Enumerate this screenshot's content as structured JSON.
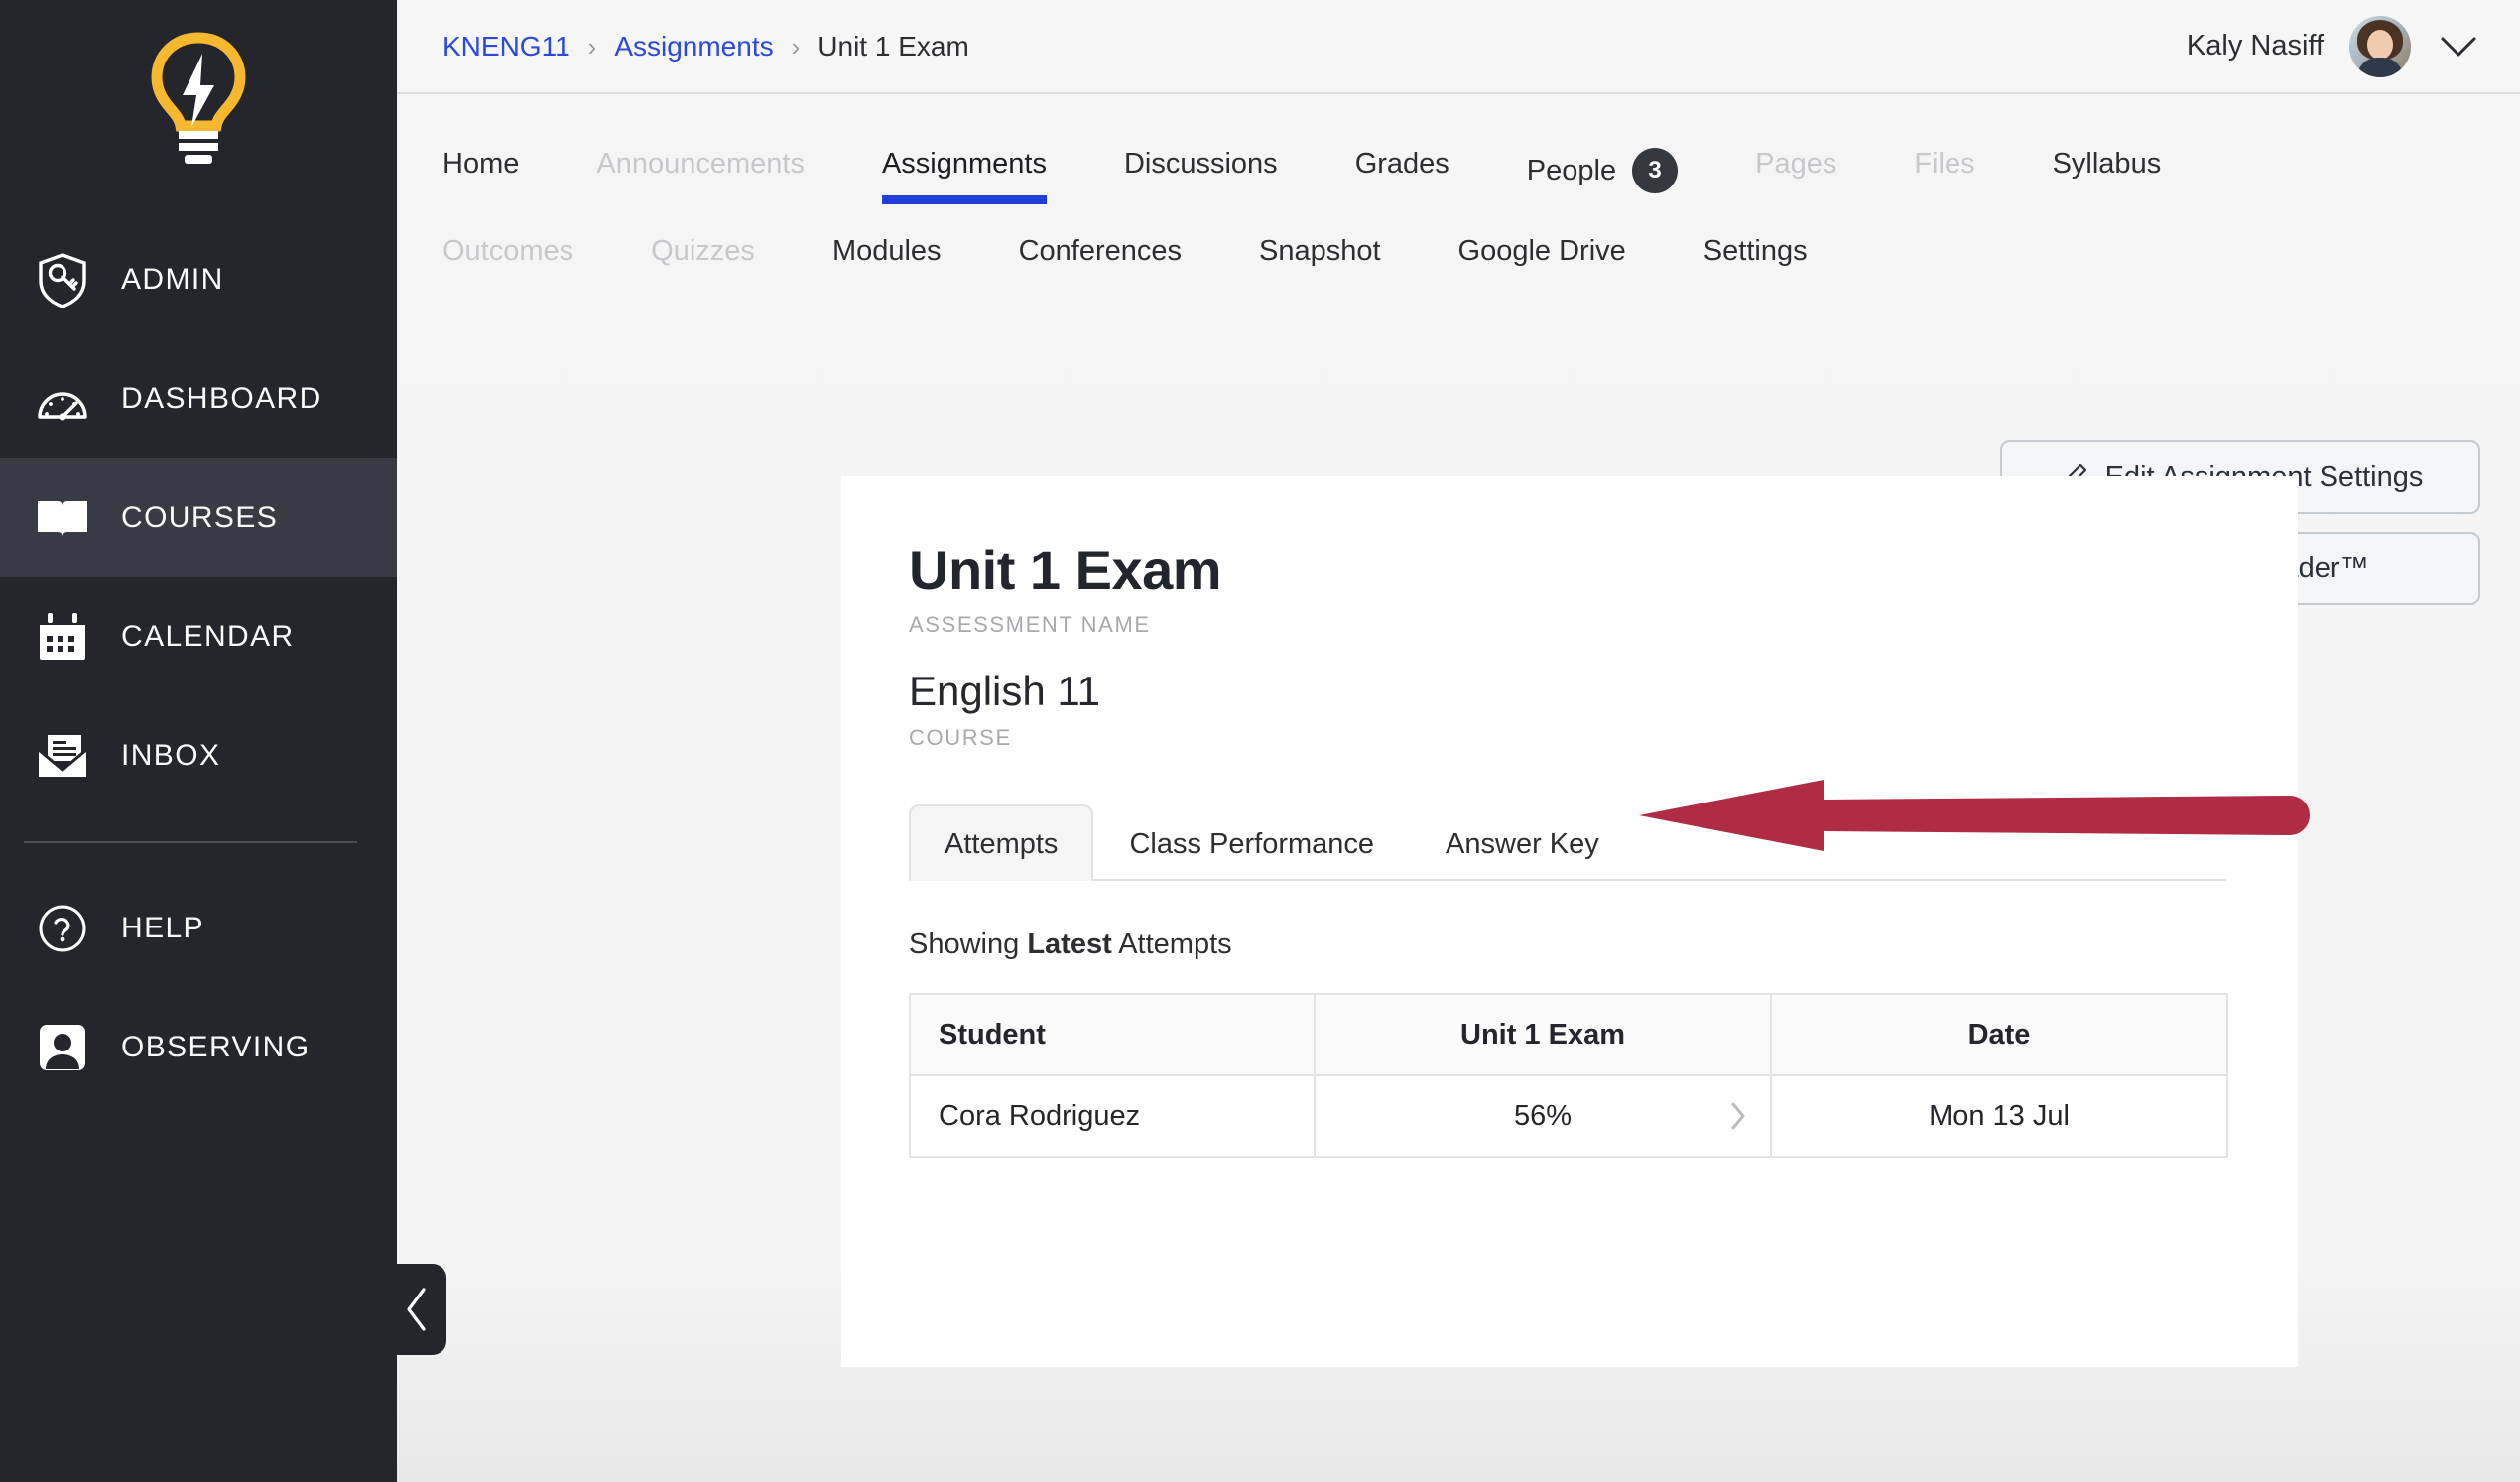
{
  "colors": {
    "sidebar_bg": "#24262b",
    "sidebar_active": "#383b44",
    "accent_blue": "#1f3fd6",
    "link_blue": "#2b49e0",
    "annotation_red": "#b02b44",
    "logo_yellow": "#f5b82e",
    "badge_dark": "#35383f"
  },
  "sidebar": {
    "logo_icon": "lightbulb-icon",
    "items": [
      {
        "label": "ADMIN",
        "icon": "shield-key-icon",
        "active": false
      },
      {
        "label": "DASHBOARD",
        "icon": "speedometer-icon",
        "active": false
      },
      {
        "label": "COURSES",
        "icon": "open-book-icon",
        "active": true
      },
      {
        "label": "CALENDAR",
        "icon": "calendar-icon",
        "active": false
      },
      {
        "label": "INBOX",
        "icon": "envelope-icon",
        "active": false
      },
      {
        "label": "HELP",
        "icon": "question-circle-icon",
        "active": false
      },
      {
        "label": "OBSERVING",
        "icon": "person-badge-icon",
        "active": false
      }
    ],
    "collapse_icon": "chevron-left-icon"
  },
  "topbar": {
    "breadcrumb": [
      {
        "label": "KNENG11",
        "link": true
      },
      {
        "label": "Assignments",
        "link": true
      },
      {
        "label": "Unit 1 Exam",
        "link": false
      }
    ],
    "separator": "›",
    "user_name": "Kaly Nasiff",
    "avatar_icon": "user-avatar",
    "caret_icon": "chevron-down-icon"
  },
  "course_nav": {
    "row1": [
      {
        "label": "Home",
        "state": "normal"
      },
      {
        "label": "Announcements",
        "state": "disabled"
      },
      {
        "label": "Assignments",
        "state": "active"
      },
      {
        "label": "Discussions",
        "state": "normal"
      },
      {
        "label": "Grades",
        "state": "normal"
      },
      {
        "label": "People",
        "state": "normal",
        "badge": "3"
      },
      {
        "label": "Pages",
        "state": "disabled"
      },
      {
        "label": "Files",
        "state": "disabled"
      },
      {
        "label": "Syllabus",
        "state": "normal"
      }
    ],
    "row2": [
      {
        "label": "Outcomes",
        "state": "disabled"
      },
      {
        "label": "Quizzes",
        "state": "disabled"
      },
      {
        "label": "Modules",
        "state": "normal"
      },
      {
        "label": "Conferences",
        "state": "normal"
      },
      {
        "label": "Snapshot",
        "state": "normal"
      },
      {
        "label": "Google Drive",
        "state": "normal"
      },
      {
        "label": "Settings",
        "state": "normal"
      }
    ]
  },
  "card": {
    "assessment_name": "Unit 1 Exam",
    "assessment_label": "ASSESSMENT NAME",
    "course_name": "English 11",
    "course_label": "COURSE",
    "tabs": [
      {
        "label": "Attempts",
        "active": true
      },
      {
        "label": "Class Performance",
        "active": false
      },
      {
        "label": "Answer Key",
        "active": false
      }
    ],
    "showing": {
      "prefix": "Showing",
      "emphasis": "Latest",
      "suffix": "Attempts"
    },
    "table": {
      "headers": [
        "Student",
        "Unit 1 Exam",
        "Date"
      ],
      "rows": [
        {
          "student": "Cora Rodriguez",
          "score": "56%",
          "date": "Mon 13 Jul",
          "chevron": "chevron-right-icon"
        }
      ]
    }
  },
  "actions": [
    {
      "label": "Edit Assignment Settings",
      "icon": "pencil-icon"
    },
    {
      "label": "Speed Grader™",
      "icon": "speed-grader-icon"
    }
  ],
  "annotation": {
    "type": "arrow-left",
    "points_to": "Answer Key",
    "color": "#b02b44"
  }
}
